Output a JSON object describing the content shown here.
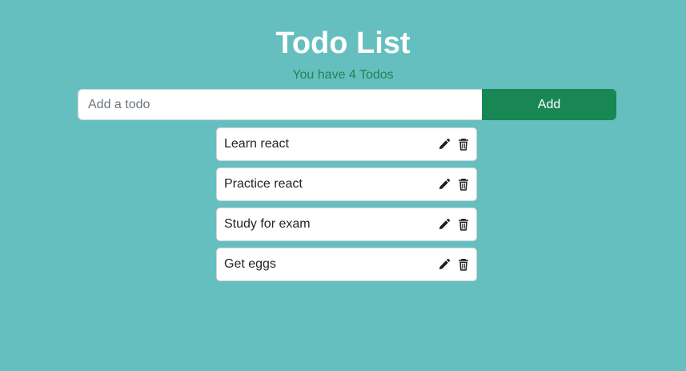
{
  "header": {
    "title": "Todo List",
    "subtitle": "You have 4 Todos"
  },
  "add_form": {
    "placeholder": "Add a todo",
    "value": "",
    "button_label": "Add"
  },
  "todos": [
    {
      "text": "Learn react",
      "edit_icon": "pencil-icon",
      "delete_icon": "trash-icon"
    },
    {
      "text": "Practice react",
      "edit_icon": "pencil-icon",
      "delete_icon": "trash-icon"
    },
    {
      "text": "Study for exam",
      "edit_icon": "pencil-icon",
      "delete_icon": "trash-icon"
    },
    {
      "text": "Get eggs",
      "edit_icon": "pencil-icon",
      "delete_icon": "trash-icon"
    }
  ],
  "colors": {
    "background": "#66bfbf",
    "accent": "#198754",
    "title": "#ffffff"
  }
}
